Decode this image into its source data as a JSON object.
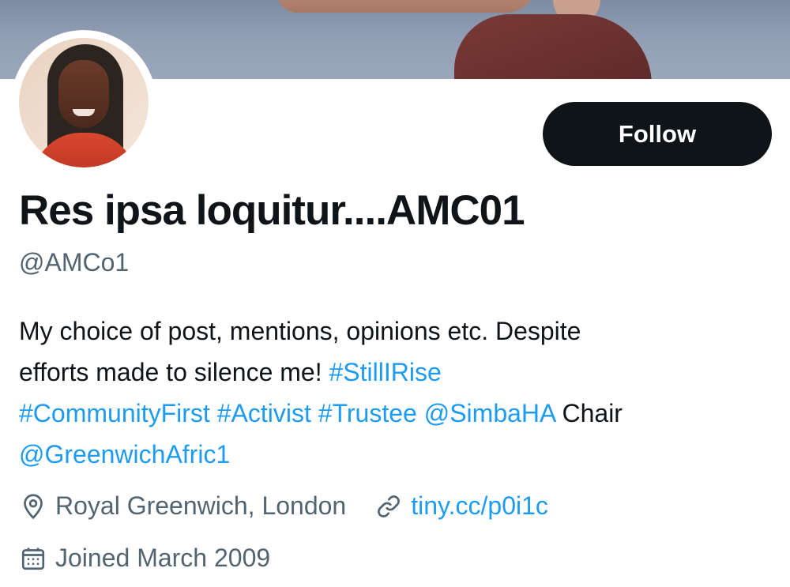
{
  "profile": {
    "display_name": "Res ipsa loquitur....AMC01",
    "handle": "@AMCo1",
    "follow_label": "Follow",
    "bio": {
      "line1": "My choice of post, mentions, opinions etc. Despite",
      "line2_text": "efforts made to silence me! ",
      "hashtag_stillirise": "#StillIRise",
      "hashtag_communityfirst": "#CommunityFirst",
      "hashtag_activist": "#Activist",
      "hashtag_trustee": "#Trustee",
      "mention_simbaha": "@SimbaHA",
      "text_chair": " Chair",
      "mention_greenwich": "@GreenwichAfric1"
    },
    "location": "Royal Greenwich, London",
    "website": "tiny.cc/p0i1c",
    "joined": "Joined March 2009"
  },
  "icons": {
    "location": "location-pin-icon",
    "link": "link-icon",
    "calendar": "calendar-icon"
  },
  "colors": {
    "link": "#1d9bf0",
    "text_primary": "#0f1419",
    "text_secondary": "#536471",
    "follow_button_bg": "#0f1419"
  }
}
